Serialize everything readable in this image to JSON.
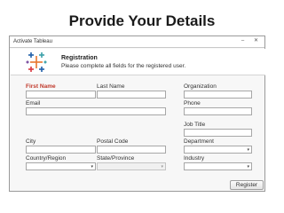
{
  "slide": {
    "title": "Provide Your Details"
  },
  "window": {
    "title": "Activate Tableau",
    "minimize": "–",
    "close": "✕"
  },
  "header": {
    "title": "Registration",
    "subtitle": "Please complete all fields for the registered user."
  },
  "form": {
    "first_name": {
      "label": "First Name",
      "value": ""
    },
    "last_name": {
      "label": "Last Name",
      "value": ""
    },
    "organization": {
      "label": "Organization",
      "value": ""
    },
    "email": {
      "label": "Email",
      "value": ""
    },
    "phone": {
      "label": "Phone",
      "value": ""
    },
    "job_title": {
      "label": "Job Title",
      "value": ""
    },
    "city": {
      "label": "City",
      "value": ""
    },
    "postal_code": {
      "label": "Postal Code",
      "value": ""
    },
    "department": {
      "label": "Department",
      "value": ""
    },
    "country": {
      "label": "Country/Region",
      "value": ""
    },
    "state": {
      "label": "State/Province",
      "value": ""
    },
    "industry": {
      "label": "Industry",
      "value": ""
    }
  },
  "actions": {
    "register_label": "Register"
  },
  "icons": {
    "dropdown": "▾"
  },
  "colors": {
    "required_label": "#c0392b",
    "logo_blue": "#1f5fa8",
    "logo_orange": "#e8762d",
    "logo_red": "#d9363e",
    "logo_teal": "#3aa0a8"
  }
}
